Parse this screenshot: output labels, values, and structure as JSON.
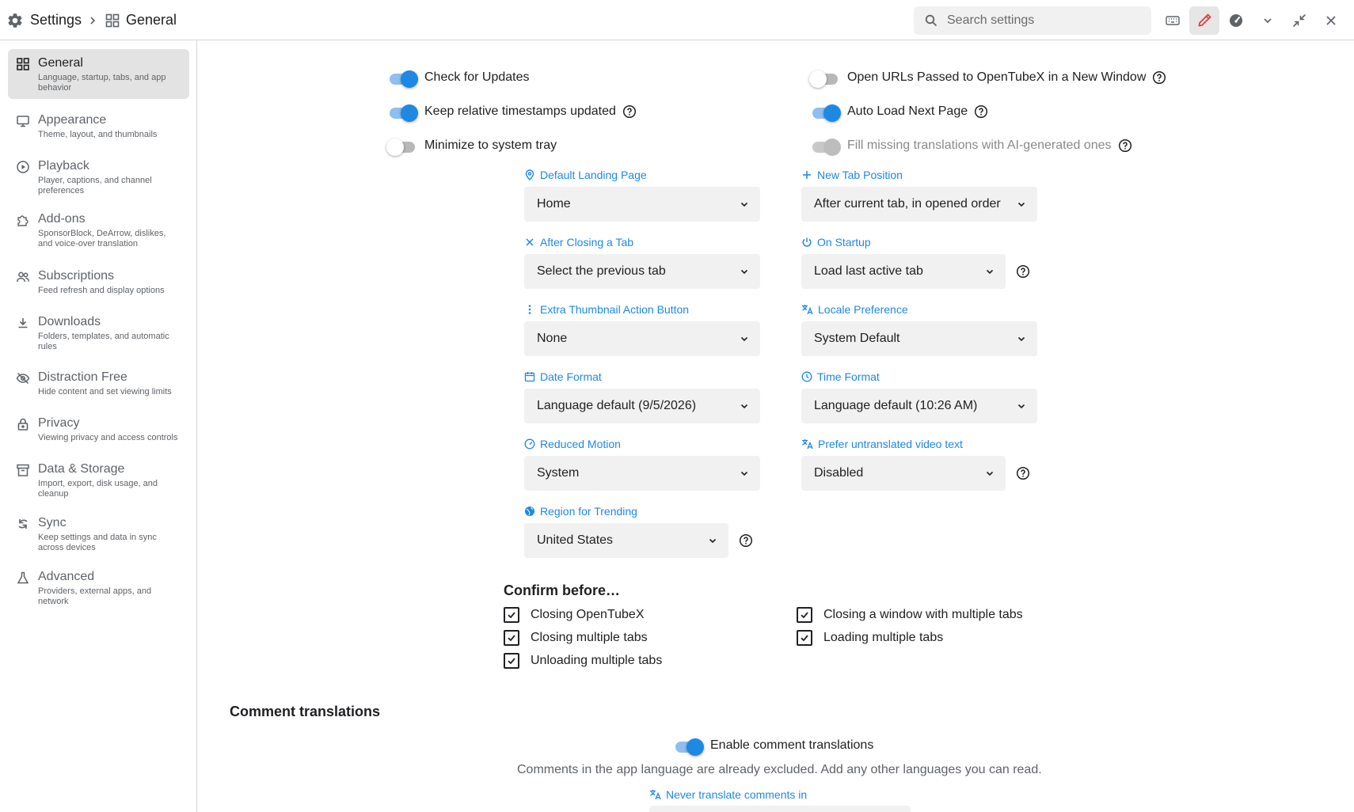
{
  "breadcrumb": {
    "root": "Settings",
    "current": "General"
  },
  "search": {
    "placeholder": "Search settings"
  },
  "sidebar": {
    "items": [
      {
        "title": "General",
        "desc": "Language, startup, tabs, and app behavior"
      },
      {
        "title": "Appearance",
        "desc": "Theme, layout, and thumbnails"
      },
      {
        "title": "Playback",
        "desc": "Player, captions, and channel preferences"
      },
      {
        "title": "Add-ons",
        "desc": "SponsorBlock, DeArrow, dislikes, and voice-over translation"
      },
      {
        "title": "Subscriptions",
        "desc": "Feed refresh and display options"
      },
      {
        "title": "Downloads",
        "desc": "Folders, templates, and automatic rules"
      },
      {
        "title": "Distraction Free",
        "desc": "Hide content and set viewing limits"
      },
      {
        "title": "Privacy",
        "desc": "Viewing privacy and access controls"
      },
      {
        "title": "Data & Storage",
        "desc": "Import, export, disk usage, and cleanup"
      },
      {
        "title": "Sync",
        "desc": "Keep settings and data in sync across devices"
      },
      {
        "title": "Advanced",
        "desc": "Providers, external apps, and network"
      }
    ]
  },
  "toggles": {
    "check_updates": {
      "label": "Check for Updates",
      "state": "on"
    },
    "relative_timestamps": {
      "label": "Keep relative timestamps updated",
      "state": "on"
    },
    "minimize_tray": {
      "label": "Minimize to system tray",
      "state": "off"
    },
    "open_urls": {
      "label": "Open URLs Passed to OpenTubeX in a New Window",
      "state": "off"
    },
    "auto_load": {
      "label": "Auto Load Next Page",
      "state": "on"
    },
    "fill_translations": {
      "label": "Fill missing translations with AI-generated ones",
      "state": "disabled"
    }
  },
  "fields": {
    "landing": {
      "label": "Default Landing Page",
      "value": "Home"
    },
    "tab_position": {
      "label": "New Tab Position",
      "value": "After current tab, in opened order"
    },
    "after_closing": {
      "label": "After Closing a Tab",
      "value": "Select the previous tab"
    },
    "on_startup": {
      "label": "On Startup",
      "value": "Load last active tab"
    },
    "thumb_button": {
      "label": "Extra Thumbnail Action Button",
      "value": "None"
    },
    "locale": {
      "label": "Locale Preference",
      "value": "System Default"
    },
    "date_format": {
      "label": "Date Format",
      "value": "Language default (9/5/2026)"
    },
    "time_format": {
      "label": "Time Format",
      "value": "Language default (10:26 AM)"
    },
    "reduced_motion": {
      "label": "Reduced Motion",
      "value": "System"
    },
    "untranslated": {
      "label": "Prefer untranslated video text",
      "value": "Disabled"
    },
    "region": {
      "label": "Region for Trending",
      "value": "United States"
    }
  },
  "confirm": {
    "title": "Confirm before…",
    "items": [
      {
        "label": "Closing OpenTubeX",
        "checked": true
      },
      {
        "label": "Closing a window with multiple tabs",
        "checked": true
      },
      {
        "label": "Closing multiple tabs",
        "checked": true
      },
      {
        "label": "Loading multiple tabs",
        "checked": true
      },
      {
        "label": "Unloading multiple tabs",
        "checked": true
      }
    ]
  },
  "comments": {
    "title": "Comment translations",
    "toggle_label": "Enable comment translations",
    "toggle_state": "on",
    "description": "Comments in the app language are already excluded. Add any other languages you can read.",
    "never_label": "Never translate comments in"
  },
  "colors": {
    "accent": "#1e88e5",
    "active_tool": "#e53935"
  }
}
